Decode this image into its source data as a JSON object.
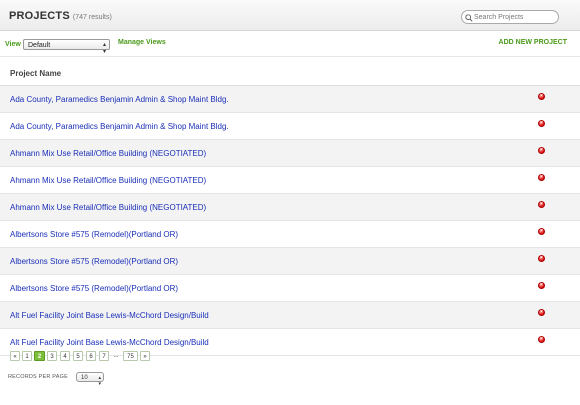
{
  "header": {
    "title": "PROJECTS",
    "result_count": "(747 results)",
    "search_placeholder": "Search Projects"
  },
  "toolbar": {
    "view_label": "View",
    "view_selected": "Default",
    "manage_views_label": "Manage Views",
    "add_new_label": "ADD NEW PROJECT"
  },
  "table": {
    "column_header": "Project Name",
    "rows": [
      "Ada County, Paramedics Benjamin Admin & Shop Maint Bldg.",
      "Ada County, Paramedics Benjamin Admin & Shop Maint Bldg.",
      "Ahmann Mix Use Retail/Office Building (NEGOTIATED)",
      "Ahmann Mix Use Retail/Office Building (NEGOTIATED)",
      "Ahmann Mix Use Retail/Office Building (NEGOTIATED)",
      "Albertsons Store #575 (Remodel)(Portland OR)",
      "Albertsons Store #575 (Remodel)(Portland OR)",
      "Albertsons Store #575 (Remodel)(Portland OR)",
      "Alt Fuel Facility Joint Base Lewis-McChord Design/Build",
      "Alt Fuel Facility Joint Base Lewis-McChord Design/Build"
    ]
  },
  "pagination": {
    "prev": "«",
    "pages": [
      "1",
      "2",
      "3",
      "4",
      "5",
      "6",
      "7"
    ],
    "current": "2",
    "ellipsis": "...",
    "last": "75",
    "next": "»"
  },
  "records_per_page": {
    "label": "RECORDS PER PAGE",
    "value": "10"
  },
  "colors": {
    "accent_green": "#4a9a1a",
    "link_blue": "#1a2fb8",
    "delete_red": "#dd1111",
    "active_page": "#7cbf3a"
  },
  "icons": {
    "search": "search-icon",
    "delete": "delete-icon",
    "dropdown": "chevron-down-icon"
  }
}
